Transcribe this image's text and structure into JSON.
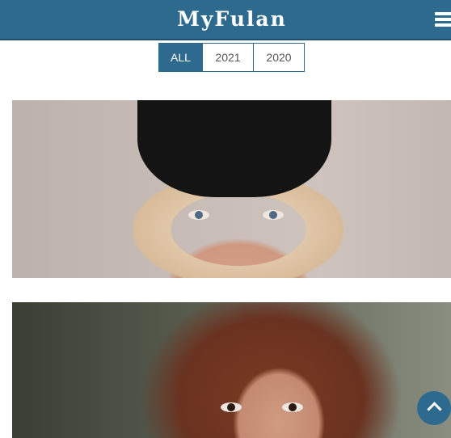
{
  "header": {
    "brand": "MyFulan",
    "menu_icon": "hamburger-menu-icon"
  },
  "filter": {
    "options": [
      "ALL",
      "2021",
      "2020"
    ],
    "active": "ALL"
  },
  "gallery": {
    "items": [
      {
        "alt": "woman-in-black-cap"
      },
      {
        "alt": "woman-with-auburn-hair"
      }
    ]
  },
  "scroll_top": {
    "icon": "chevron-up-icon"
  },
  "colors": {
    "accent": "#2e6a8d",
    "background": "#ffffff"
  }
}
